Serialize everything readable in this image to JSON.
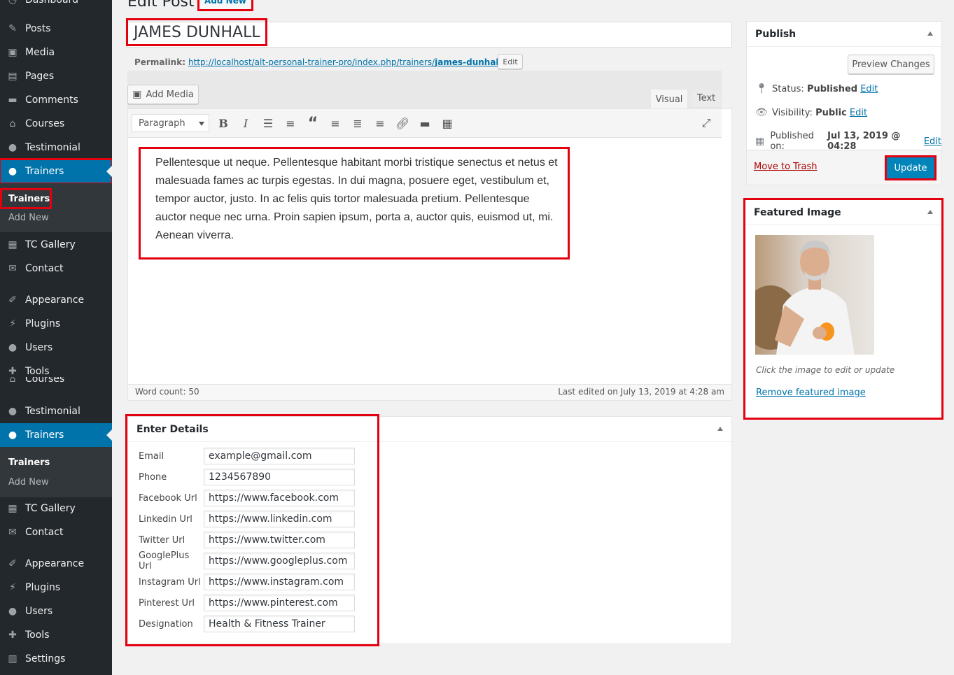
{
  "sidebar": {
    "items": [
      {
        "label": "Dashboard",
        "icon": "dashboard-icon"
      },
      {
        "label": "Posts",
        "icon": "pin-icon"
      },
      {
        "label": "Media",
        "icon": "media-icon"
      },
      {
        "label": "Pages",
        "icon": "page-icon"
      },
      {
        "label": "Comments",
        "icon": "comment-icon"
      },
      {
        "label": "Courses",
        "icon": "courses-icon"
      },
      {
        "label": "Testimonial",
        "icon": "user-icon"
      },
      {
        "label": "Trainers",
        "icon": "user-icon"
      },
      {
        "label": "TC Gallery",
        "icon": "gallery-icon"
      },
      {
        "label": "Contact",
        "icon": "mail-icon"
      },
      {
        "label": "Appearance",
        "icon": "brush-icon"
      },
      {
        "label": "Plugins",
        "icon": "plugin-icon"
      },
      {
        "label": "Users",
        "icon": "user-icon"
      },
      {
        "label": "Tools",
        "icon": "wrench-icon"
      },
      {
        "label": "Courses",
        "icon": "courses-icon"
      },
      {
        "label": "Testimonial",
        "icon": "user-icon"
      },
      {
        "label": "Trainers",
        "icon": "user-icon"
      },
      {
        "label": "TC Gallery",
        "icon": "gallery-icon"
      },
      {
        "label": "Contact",
        "icon": "mail-icon"
      },
      {
        "label": "Appearance",
        "icon": "brush-icon"
      },
      {
        "label": "Plugins",
        "icon": "plugin-icon"
      },
      {
        "label": "Users",
        "icon": "user-icon"
      },
      {
        "label": "Tools",
        "icon": "wrench-icon"
      },
      {
        "label": "Settings",
        "icon": "settings-icon"
      }
    ],
    "submenu": {
      "current": "Trainers",
      "add_new": "Add New"
    }
  },
  "header": {
    "title": "Edit Post",
    "add_new": "Add New"
  },
  "post": {
    "title": "JAMES DUNHALL",
    "permalink_label": "Permalink:",
    "permalink_base": "http://localhost/alt-personal-trainer-pro/index.php/trainers/",
    "permalink_slug": "james-dunhall",
    "permalink_end": "/",
    "permalink_edit": "Edit"
  },
  "editor": {
    "add_media": "Add Media",
    "tab_visual": "Visual",
    "tab_text": "Text",
    "format": "Paragraph",
    "content": "Pellentesque ut neque. Pellentesque habitant morbi tristique senectus et netus et malesuada fames ac turpis egestas. In dui magna, posuere eget, vestibulum et, tempor auctor, justo. In ac felis quis tortor malesuada pretium. Pellentesque auctor neque nec urna. Proin sapien ipsum, porta a, auctor quis, euismod ut, mi. Aenean viverra.",
    "word_count": "Word count: 50",
    "last_edited": "Last edited on July 13, 2019 at 4:28 am"
  },
  "publish": {
    "title": "Publish",
    "preview": "Preview Changes",
    "status_label": "Status:",
    "status_value": "Published",
    "visibility_label": "Visibility:",
    "visibility_value": "Public",
    "published_label": "Published on:",
    "published_value": "Jul 13, 2019 @ 04:28",
    "edit": "Edit",
    "trash": "Move to Trash",
    "update": "Update"
  },
  "featured": {
    "title": "Featured Image",
    "hint": "Click the image to edit or update",
    "remove": "Remove featured image"
  },
  "details": {
    "title": "Enter Details",
    "fields": [
      {
        "label": "Email",
        "value": "example@gmail.com"
      },
      {
        "label": "Phone",
        "value": "1234567890"
      },
      {
        "label": "Facebook Url",
        "value": "https://www.facebook.com"
      },
      {
        "label": "Linkedin Url",
        "value": "https://www.linkedin.com"
      },
      {
        "label": "Twitter Url",
        "value": "https://www.twitter.com"
      },
      {
        "label": "GooglePlus Url",
        "value": "https://www.googleplus.com"
      },
      {
        "label": "Instagram Url",
        "value": "https://www.instagram.com"
      },
      {
        "label": "Pinterest Url",
        "value": "https://www.pinterest.com"
      },
      {
        "label": "Designation",
        "value": "Health & Fitness Trainer"
      }
    ]
  },
  "colors": {
    "accent": "#0073aa",
    "highlight": "#e3000f",
    "sidebar": "#23282d"
  }
}
